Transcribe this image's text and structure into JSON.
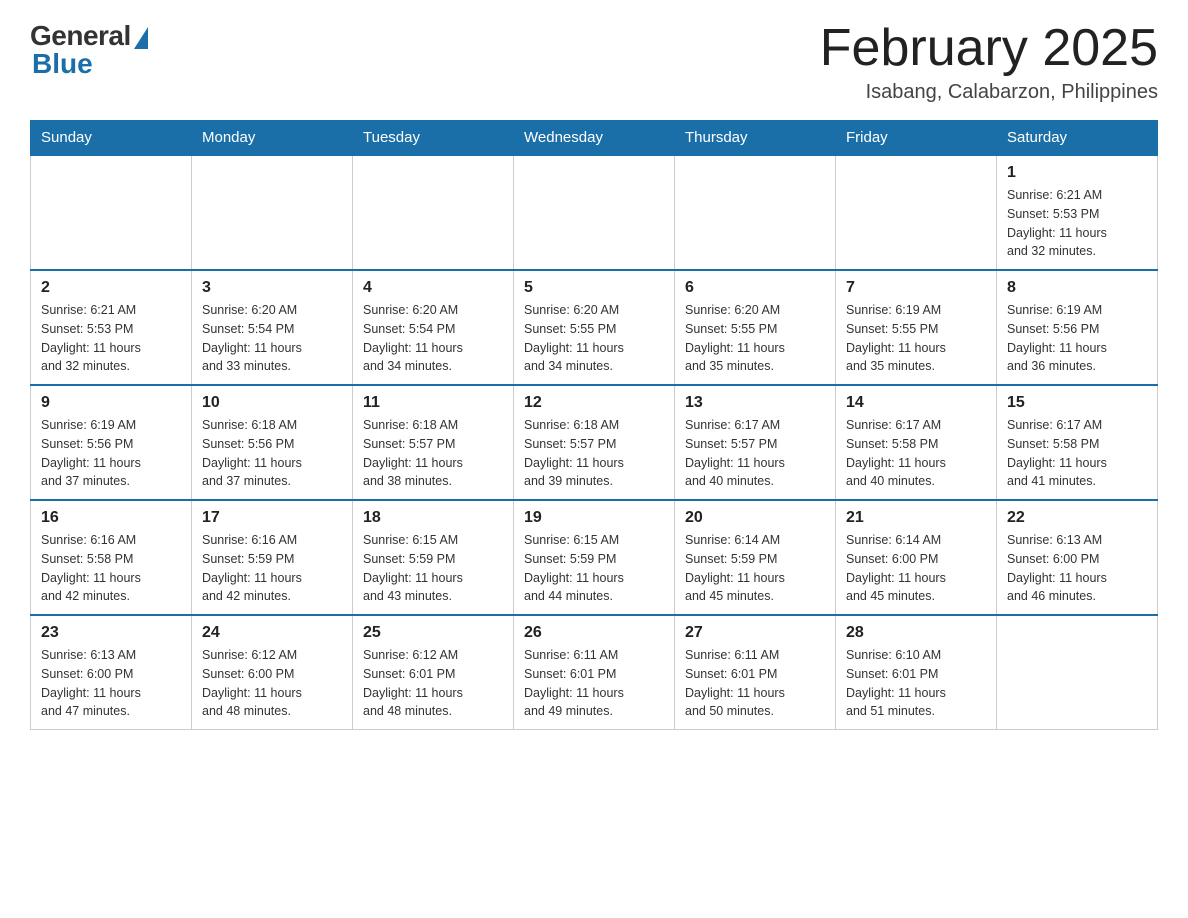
{
  "header": {
    "logo_general": "General",
    "logo_blue": "Blue",
    "title": "February 2025",
    "subtitle": "Isabang, Calabarzon, Philippines"
  },
  "weekdays": [
    "Sunday",
    "Monday",
    "Tuesday",
    "Wednesday",
    "Thursday",
    "Friday",
    "Saturday"
  ],
  "weeks": [
    [
      {
        "day": "",
        "info": ""
      },
      {
        "day": "",
        "info": ""
      },
      {
        "day": "",
        "info": ""
      },
      {
        "day": "",
        "info": ""
      },
      {
        "day": "",
        "info": ""
      },
      {
        "day": "",
        "info": ""
      },
      {
        "day": "1",
        "info": "Sunrise: 6:21 AM\nSunset: 5:53 PM\nDaylight: 11 hours\nand 32 minutes."
      }
    ],
    [
      {
        "day": "2",
        "info": "Sunrise: 6:21 AM\nSunset: 5:53 PM\nDaylight: 11 hours\nand 32 minutes."
      },
      {
        "day": "3",
        "info": "Sunrise: 6:20 AM\nSunset: 5:54 PM\nDaylight: 11 hours\nand 33 minutes."
      },
      {
        "day": "4",
        "info": "Sunrise: 6:20 AM\nSunset: 5:54 PM\nDaylight: 11 hours\nand 34 minutes."
      },
      {
        "day": "5",
        "info": "Sunrise: 6:20 AM\nSunset: 5:55 PM\nDaylight: 11 hours\nand 34 minutes."
      },
      {
        "day": "6",
        "info": "Sunrise: 6:20 AM\nSunset: 5:55 PM\nDaylight: 11 hours\nand 35 minutes."
      },
      {
        "day": "7",
        "info": "Sunrise: 6:19 AM\nSunset: 5:55 PM\nDaylight: 11 hours\nand 35 minutes."
      },
      {
        "day": "8",
        "info": "Sunrise: 6:19 AM\nSunset: 5:56 PM\nDaylight: 11 hours\nand 36 minutes."
      }
    ],
    [
      {
        "day": "9",
        "info": "Sunrise: 6:19 AM\nSunset: 5:56 PM\nDaylight: 11 hours\nand 37 minutes."
      },
      {
        "day": "10",
        "info": "Sunrise: 6:18 AM\nSunset: 5:56 PM\nDaylight: 11 hours\nand 37 minutes."
      },
      {
        "day": "11",
        "info": "Sunrise: 6:18 AM\nSunset: 5:57 PM\nDaylight: 11 hours\nand 38 minutes."
      },
      {
        "day": "12",
        "info": "Sunrise: 6:18 AM\nSunset: 5:57 PM\nDaylight: 11 hours\nand 39 minutes."
      },
      {
        "day": "13",
        "info": "Sunrise: 6:17 AM\nSunset: 5:57 PM\nDaylight: 11 hours\nand 40 minutes."
      },
      {
        "day": "14",
        "info": "Sunrise: 6:17 AM\nSunset: 5:58 PM\nDaylight: 11 hours\nand 40 minutes."
      },
      {
        "day": "15",
        "info": "Sunrise: 6:17 AM\nSunset: 5:58 PM\nDaylight: 11 hours\nand 41 minutes."
      }
    ],
    [
      {
        "day": "16",
        "info": "Sunrise: 6:16 AM\nSunset: 5:58 PM\nDaylight: 11 hours\nand 42 minutes."
      },
      {
        "day": "17",
        "info": "Sunrise: 6:16 AM\nSunset: 5:59 PM\nDaylight: 11 hours\nand 42 minutes."
      },
      {
        "day": "18",
        "info": "Sunrise: 6:15 AM\nSunset: 5:59 PM\nDaylight: 11 hours\nand 43 minutes."
      },
      {
        "day": "19",
        "info": "Sunrise: 6:15 AM\nSunset: 5:59 PM\nDaylight: 11 hours\nand 44 minutes."
      },
      {
        "day": "20",
        "info": "Sunrise: 6:14 AM\nSunset: 5:59 PM\nDaylight: 11 hours\nand 45 minutes."
      },
      {
        "day": "21",
        "info": "Sunrise: 6:14 AM\nSunset: 6:00 PM\nDaylight: 11 hours\nand 45 minutes."
      },
      {
        "day": "22",
        "info": "Sunrise: 6:13 AM\nSunset: 6:00 PM\nDaylight: 11 hours\nand 46 minutes."
      }
    ],
    [
      {
        "day": "23",
        "info": "Sunrise: 6:13 AM\nSunset: 6:00 PM\nDaylight: 11 hours\nand 47 minutes."
      },
      {
        "day": "24",
        "info": "Sunrise: 6:12 AM\nSunset: 6:00 PM\nDaylight: 11 hours\nand 48 minutes."
      },
      {
        "day": "25",
        "info": "Sunrise: 6:12 AM\nSunset: 6:01 PM\nDaylight: 11 hours\nand 48 minutes."
      },
      {
        "day": "26",
        "info": "Sunrise: 6:11 AM\nSunset: 6:01 PM\nDaylight: 11 hours\nand 49 minutes."
      },
      {
        "day": "27",
        "info": "Sunrise: 6:11 AM\nSunset: 6:01 PM\nDaylight: 11 hours\nand 50 minutes."
      },
      {
        "day": "28",
        "info": "Sunrise: 6:10 AM\nSunset: 6:01 PM\nDaylight: 11 hours\nand 51 minutes."
      },
      {
        "day": "",
        "info": ""
      }
    ]
  ]
}
